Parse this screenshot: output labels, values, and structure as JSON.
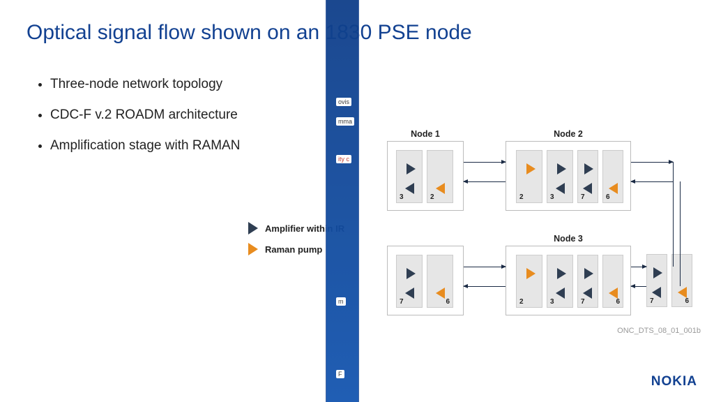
{
  "title": "Optical signal flow shown on an 1830 PSE node",
  "bullets": [
    "Three-node network topology",
    "CDC-F v.2 ROADM architecture",
    "Amplification stage with RAMAN"
  ],
  "legend": {
    "amplifier": "Amplifier within IR",
    "raman": "Raman pump"
  },
  "diagram": {
    "nodes": [
      {
        "label": "Node 1",
        "slots": [
          "3",
          "2",
          "6",
          "7"
        ]
      },
      {
        "label": "Node 2",
        "slots": [
          "2",
          "3",
          "7",
          "6"
        ]
      },
      {
        "label": "Node 3",
        "slots": [
          "2",
          "3",
          "7",
          "6"
        ]
      }
    ],
    "figure_ref": "ONC_DTS_08_01_001b"
  },
  "strip_labels": {
    "a": "ovis",
    "b": "mma",
    "c": "ity c",
    "d": "m",
    "e": "F"
  },
  "brand": "NOKIA"
}
